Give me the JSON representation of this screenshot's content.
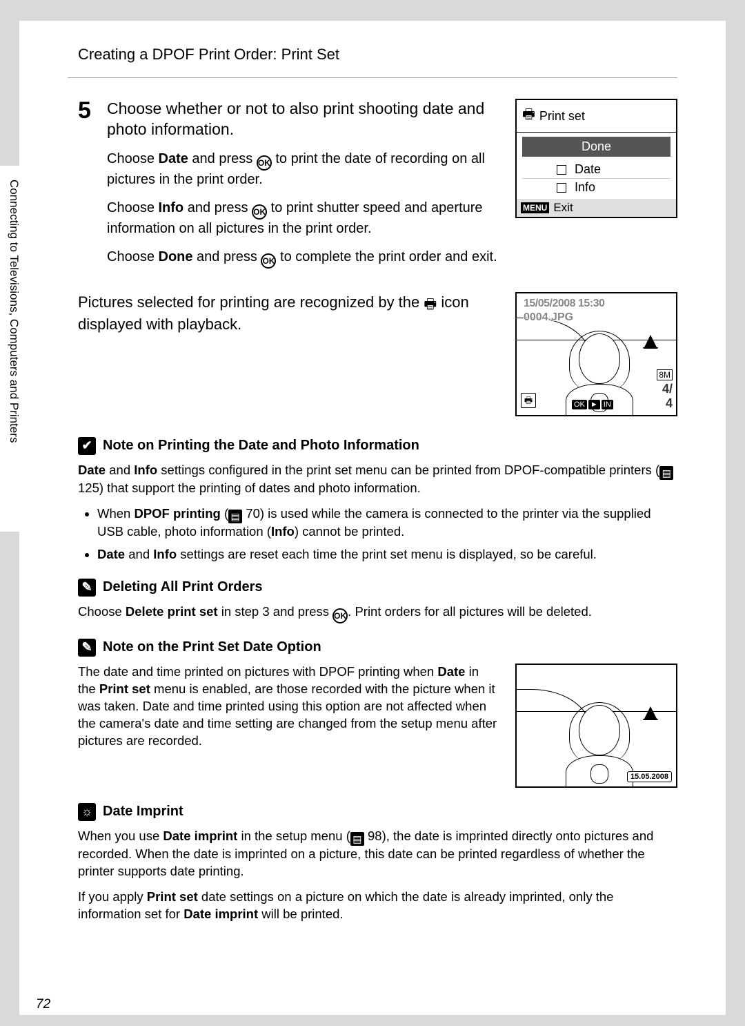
{
  "header": {
    "title": "Creating a DPOF Print Order: Print Set"
  },
  "sideTab": "Connecting to Televisions, Computers and Printers",
  "step": {
    "num": "5",
    "head": "Choose whether or not to also print shooting date and photo information.",
    "p1a": "Choose ",
    "p1b": "Date",
    "p1c": " and press ",
    "p1d": " to print the date of recording on all pictures in the print order.",
    "p2a": "Choose ",
    "p2b": "Info",
    "p2c": " and press ",
    "p2d": " to print shutter speed and aperture information on all pictures in the print order.",
    "p3a": "Choose ",
    "p3b": "Done",
    "p3c": " and press ",
    "p3d": " to complete the print order and exit."
  },
  "menu": {
    "title": "Print set",
    "done": "Done",
    "date": "Date",
    "info": "Info",
    "exitTag": "MENU",
    "exit": "Exit"
  },
  "playback": {
    "text1": "Pictures selected for printing are recognized by the ",
    "text2": " icon displayed with playback.",
    "date": "15/05/2008 15:30",
    "file": "0004.JPG",
    "badge": "8M",
    "count1": "4/",
    "count2": "4"
  },
  "note1": {
    "title": "Note on Printing the Date and Photo Information",
    "p_a": "Date",
    "p_b": " and ",
    "p_c": "Info",
    "p_d": " settings configured in the print set menu can be printed from DPOF-compatible printers (",
    "p_ref1": "125",
    "p_e": ") that support the printing of dates and photo information.",
    "b1a": "When ",
    "b1b": "DPOF printing",
    "b1c": " (",
    "b1ref": "70",
    "b1d": ") is used while the camera is connected to the printer via the supplied USB cable, photo information (",
    "b1e": "Info",
    "b1f": ") cannot be printed.",
    "b2a": "Date",
    "b2b": " and ",
    "b2c": "Info",
    "b2d": " settings are reset each time the print set menu is displayed, so be careful."
  },
  "note2": {
    "title": "Deleting All Print Orders",
    "pa": "Choose ",
    "pb": "Delete print set",
    "pc": " in step 3 and press ",
    "pd": ". Print orders for all pictures will be deleted."
  },
  "note3": {
    "title": "Note on the Print Set Date Option",
    "pa": "The date and time printed on pictures with DPOF printing when ",
    "pb": "Date",
    "pc": " in the ",
    "pd": "Print set",
    "pe": " menu is enabled, are those recorded with the picture when it was taken. Date and time printed using this option are not affected when the camera's date and time setting are changed from the setup menu after pictures are recorded.",
    "imprint": "15.05.2008"
  },
  "note4": {
    "title": "Date Imprint",
    "pa": "When you use ",
    "pb": "Date imprint",
    "pc": " in the setup menu (",
    "pref": "98",
    "pd": "), the date is imprinted directly onto pictures and recorded. When the date is imprinted on a picture, this date can be printed regardless of whether the printer supports date printing.",
    "qa": "If you apply ",
    "qb": "Print set",
    "qc": " date settings on a picture on which the date is already imprinted, only the information set for ",
    "qd": "Date imprint",
    "qe": " will be printed."
  },
  "pageNum": "72"
}
